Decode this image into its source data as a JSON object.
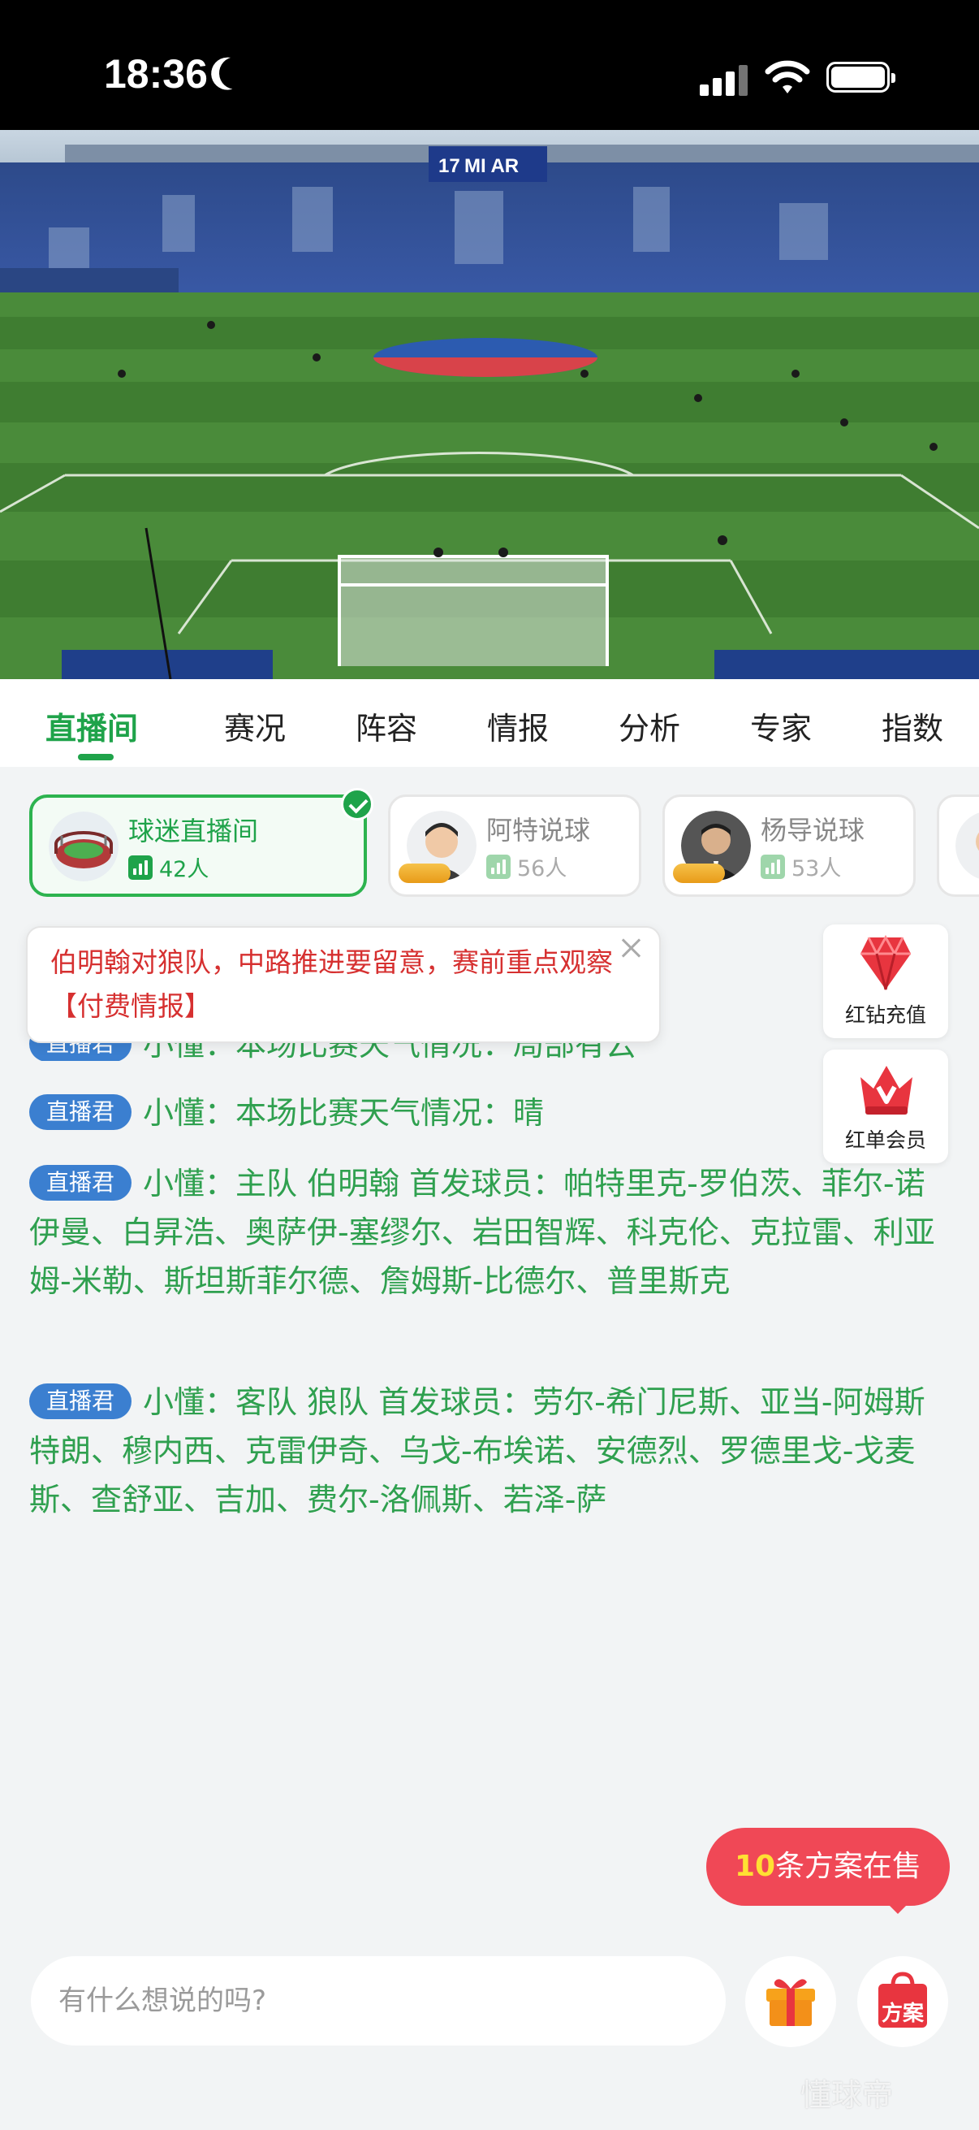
{
  "status_bar": {
    "time": "18:36",
    "icons": [
      "moon-icon",
      "cellular-signal-icon",
      "wifi-icon",
      "battery-icon"
    ]
  },
  "video": {
    "scoreboard_number": "17",
    "scoreboard_text": "MI AR"
  },
  "tabs": [
    {
      "label": "直播间",
      "active": true
    },
    {
      "label": "赛况"
    },
    {
      "label": "阵容"
    },
    {
      "label": "情报"
    },
    {
      "label": "分析"
    },
    {
      "label": "专家"
    },
    {
      "label": "指数"
    }
  ],
  "streamers": [
    {
      "name": "球迷直播间",
      "viewers": "42人",
      "selected": true
    },
    {
      "name": "阿特说球",
      "viewers": "56人",
      "badge": "王牌"
    },
    {
      "name": "杨导说球",
      "viewers": "53人",
      "badge": "王牌"
    }
  ],
  "tip": {
    "text": "伯明翰对狼队，中路推进要留意，赛前重点观察【付费情报】"
  },
  "side_buttons": [
    {
      "label": "红钻充值",
      "icon": "red-diamond-icon"
    },
    {
      "label": "红单会员",
      "icon": "crown-v-icon"
    }
  ],
  "chat": {
    "tag": "直播君",
    "partial_message": "小懂：本场比赛天气情况：局部有云",
    "messages": [
      "小懂：本场比赛天气情况：晴",
      "小懂：主队 伯明翰 首发球员：帕特里克-罗伯茨、菲尔-诺伊曼、白昇浩、奥萨伊-塞缪尔、岩田智辉、科克伦、克拉雷、利亚姆-米勒、斯坦斯菲尔德、詹姆斯-比德尔、普里斯克",
      "小懂：客队 狼队 首发球员：劳尔-希门尼斯、亚当-阿姆斯特朗、穆内西、克雷伊奇、乌戈-布埃诺、安德烈、罗德里戈-戈麦斯、查舒亚、吉加、费尔-洛佩斯、若泽-萨"
    ]
  },
  "plans": {
    "count": "10",
    "label": "条方案在售"
  },
  "input": {
    "placeholder": "有什么想说的吗?"
  },
  "buttons": {
    "plan_label": "方案",
    "gift_icon": "gift-icon"
  },
  "watermark": "懂球帝",
  "colors": {
    "accent": "#1fa34a",
    "tag_blue": "#3b7fd0",
    "tip_red": "#d63030",
    "plans_red": "#f04856"
  }
}
